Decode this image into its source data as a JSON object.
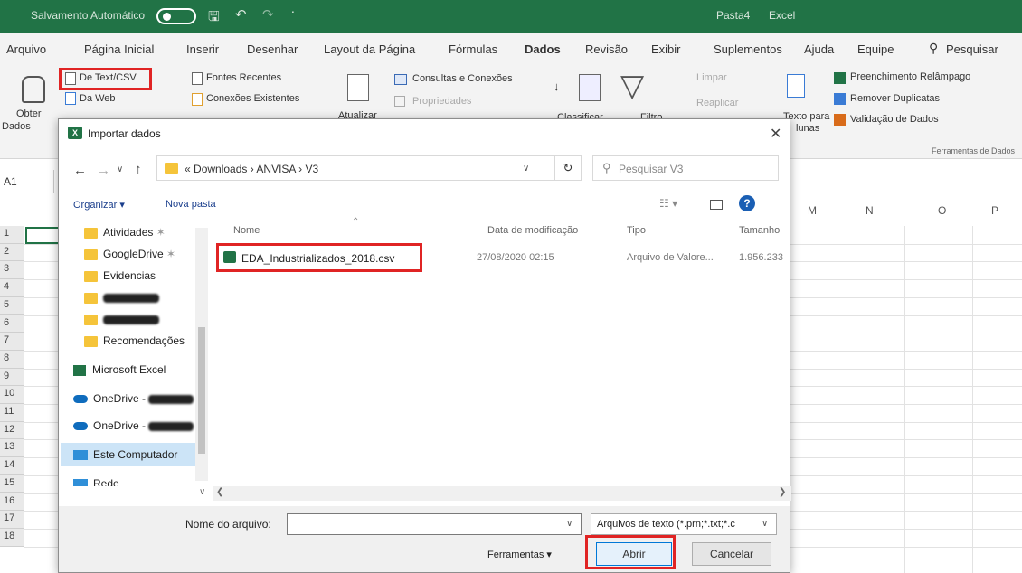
{
  "titlebar": {
    "autosave_label": "Salvamento Automático",
    "doc_title": "Pasta4",
    "app_name": "Excel"
  },
  "menu": [
    "Arquivo",
    "Página Inicial",
    "Inserir",
    "Desenhar",
    "Layout da Página",
    "Fórmulas",
    "Dados",
    "Revisão",
    "Exibir",
    "Suplementos",
    "Ajuda",
    "Equipe",
    "Pesquisar"
  ],
  "ribbon": {
    "obter_dados_line1": "Obter",
    "obter_dados_line2": "Dados",
    "de_texto_csv": "De Text/CSV",
    "da_web": "Da Web",
    "fontes_recentes": "Fontes Recentes",
    "conexoes_existentes": "Conexões Existentes",
    "atualizar": "Atualizar",
    "consultas_conexoes": "Consultas e Conexões",
    "propriedades": "Propriedades",
    "classificar": "Classificar",
    "filtro": "Filtro",
    "limpar": "Limpar",
    "reaplicar": "Reaplicar",
    "texto_para_line1": "Texto para",
    "texto_para_line2": "lunas",
    "preenchimento": "Preenchimento Relâmpago",
    "remover_duplicatas": "Remover Duplicatas",
    "validacao": "Validação de Dados",
    "ferramentas_dados": "Ferramentas de Dados"
  },
  "namebox": "A1",
  "sheet": {
    "rows": [
      "1",
      "2",
      "3",
      "4",
      "5",
      "6",
      "7",
      "8",
      "9",
      "10",
      "11",
      "12",
      "13",
      "14",
      "15",
      "16",
      "17",
      "18"
    ],
    "cols": [
      "M",
      "N",
      "O",
      "P"
    ]
  },
  "dialog": {
    "title": "Importar dados",
    "breadcrumb": {
      "prefix": "«",
      "parts": [
        "Downloads",
        "ANVISA",
        "V3"
      ]
    },
    "search_placeholder": "Pesquisar V3",
    "organizar": "Organizar",
    "nova_pasta": "Nova pasta",
    "nav_items": [
      "Atividades",
      "GoogleDrive",
      "Evidencias",
      "Recomendações",
      "Microsoft Excel",
      "OneDrive -",
      "OneDrive -",
      "Este Computador",
      "Rede"
    ],
    "columns": {
      "nome": "Nome",
      "data": "Data de modificação",
      "tipo": "Tipo",
      "tamanho": "Tamanho"
    },
    "file": {
      "name": "EDA_Industrializados_2018.csv",
      "date": "27/08/2020 02:15",
      "type": "Arquivo de Valore...",
      "size": "1.956.233"
    },
    "filename_label": "Nome do arquivo:",
    "filename_value": "",
    "filter": "Arquivos de texto (*.prn;*.txt;*.c",
    "ferramentas": "Ferramentas",
    "abrir": "Abrir",
    "cancelar": "Cancelar"
  },
  "colors": {
    "excel_green": "#217346",
    "highlight_red": "#e02424",
    "folder_yellow": "#f5c43a",
    "onedrive_blue": "#0f6cbd"
  }
}
